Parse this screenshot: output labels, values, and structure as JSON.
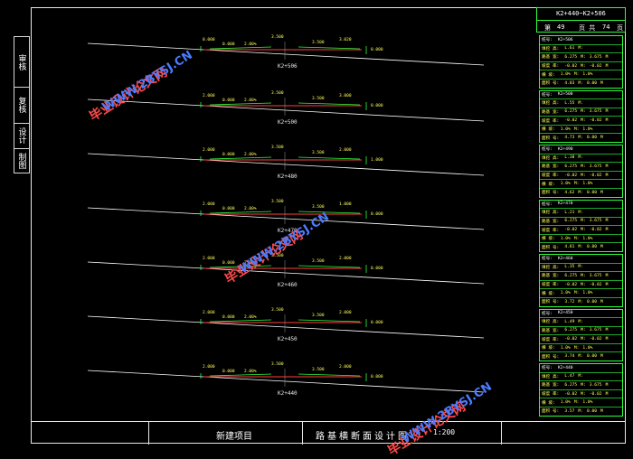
{
  "left_tab": {
    "cells": [
      "审核",
      "复核",
      "设计",
      "制图"
    ]
  },
  "sheet": {
    "title": "K2+440~K2+506",
    "page_current": "49",
    "page_total": "74"
  },
  "sections": [
    {
      "station": "K2+506",
      "left": [
        "0.000",
        "0.000"
      ],
      "right": [
        "3.020",
        "0.000"
      ],
      "mid": [
        "3.500",
        "2.00%"
      ]
    },
    {
      "station": "K2+500",
      "left": [
        "2.000",
        "0.000"
      ],
      "right": [
        "3.000",
        "0.000"
      ],
      "mid": [
        "3.500",
        "2.00%"
      ]
    },
    {
      "station": "K2+480",
      "left": [
        "2.000",
        "0.000"
      ],
      "right": [
        "2.000",
        "1.000"
      ],
      "mid": [
        "3.500",
        "2.00%"
      ]
    },
    {
      "station": "K2+470",
      "left": [
        "2.000",
        "0.000"
      ],
      "right": [
        "1.000",
        "0.000"
      ],
      "mid": [
        "3.500",
        "2.00%"
      ]
    },
    {
      "station": "K2+460",
      "left": [
        "2.000",
        "0.000"
      ],
      "right": [
        "2.000",
        "0.000"
      ],
      "mid": [
        "3.500",
        "2.00%"
      ]
    },
    {
      "station": "K2+450",
      "left": [
        "2.000",
        "0.000"
      ],
      "right": [
        "2.000",
        "0.000"
      ],
      "mid": [
        "3.500",
        "2.00%"
      ]
    },
    {
      "station": "K2+440",
      "left": [
        "2.000",
        "0.000"
      ],
      "right": [
        "2.000",
        "0.000"
      ],
      "mid": [
        "3.500",
        "2.00%"
      ]
    }
  ],
  "tables": [
    {
      "station": "K2+506",
      "rows": [
        [
          "桩号:",
          "K2+506"
        ],
        [
          "填挖 高:",
          "L.61",
          "M:"
        ],
        [
          "路基 宽:",
          "6.275",
          "M:",
          "3.675",
          "M"
        ],
        [
          "坡度 率:",
          "-0.02",
          "M:",
          "-0.02",
          "M"
        ],
        [
          "横 坡:",
          "1.0%",
          "M:",
          "1.0%"
        ],
        [
          "面积 号:",
          "4.83",
          "M:",
          "0.00",
          "M"
        ]
      ]
    },
    {
      "station": "K2+500",
      "rows": [
        [
          "桩号:",
          "K2+500"
        ],
        [
          "填挖 高:",
          "L.55",
          "M:"
        ],
        [
          "路基 宽:",
          "6.275",
          "M:",
          "3.675",
          "M"
        ],
        [
          "坡度 率:",
          "-0.02",
          "M:",
          "-0.02",
          "M"
        ],
        [
          "横 坡:",
          "1.0%",
          "M:",
          "1.0%"
        ],
        [
          "面积 号:",
          "4.73",
          "M:",
          "0.00",
          "M"
        ]
      ]
    },
    {
      "station": "K2+490",
      "rows": [
        [
          "桩号:",
          "K2+490"
        ],
        [
          "填挖 高:",
          "L.38",
          "M:"
        ],
        [
          "路基 宽:",
          "6.275",
          "M:",
          "3.675",
          "M"
        ],
        [
          "坡度 率:",
          "-0.02",
          "M:",
          "-0.02",
          "M"
        ],
        [
          "横 坡:",
          "1.0%",
          "M:",
          "1.0%"
        ],
        [
          "面积 号:",
          "4.62",
          "M:",
          "0.00",
          "M"
        ]
      ]
    },
    {
      "station": "K2+470",
      "rows": [
        [
          "桩号:",
          "K2+470"
        ],
        [
          "填挖 高:",
          "L.21",
          "M:"
        ],
        [
          "路基 宽:",
          "6.275",
          "M:",
          "3.675",
          "M"
        ],
        [
          "坡度 率:",
          "-0.02",
          "M:",
          "-0.02",
          "M"
        ],
        [
          "横 坡:",
          "1.0%",
          "M:",
          "1.0%"
        ],
        [
          "面积 号:",
          "4.81",
          "M:",
          "0.00",
          "M"
        ]
      ]
    },
    {
      "station": "K2+460",
      "rows": [
        [
          "桩号:",
          "K2+460"
        ],
        [
          "填挖 高:",
          "L.35",
          "M:"
        ],
        [
          "路基 宽:",
          "6.275",
          "M:",
          "3.675",
          "M"
        ],
        [
          "坡度 率:",
          "-0.02",
          "M:",
          "-0.02",
          "M"
        ],
        [
          "横 坡:",
          "1.0%",
          "M:",
          "1.0%"
        ],
        [
          "面积 号:",
          "3.72",
          "M:",
          "0.00",
          "M"
        ]
      ]
    },
    {
      "station": "K2+450",
      "rows": [
        [
          "桩号:",
          "K2+450"
        ],
        [
          "填挖 高:",
          "L.49",
          "M:"
        ],
        [
          "路基 宽:",
          "6.275",
          "M:",
          "3.675",
          "M"
        ],
        [
          "坡度 率:",
          "-0.02",
          "M:",
          "-0.02",
          "M"
        ],
        [
          "横 坡:",
          "1.0%",
          "M:",
          "1.0%"
        ],
        [
          "面积 号:",
          "3.74",
          "M:",
          "0.00",
          "M"
        ]
      ]
    },
    {
      "station": "K2+440",
      "rows": [
        [
          "桩号:",
          "K2+440"
        ],
        [
          "填挖 高:",
          "L.47",
          "M:"
        ],
        [
          "路基 宽:",
          "6.275",
          "M:",
          "3.675",
          "M"
        ],
        [
          "坡度 率:",
          "-0.02",
          "M:",
          "-0.02",
          "M"
        ],
        [
          "横 坡:",
          "1.0%",
          "M:",
          "1.0%"
        ],
        [
          "面积 号:",
          "3.57",
          "M:",
          "0.00",
          "M"
        ]
      ]
    }
  ],
  "title_block": {
    "project": "新建项目",
    "drawing": "路基横断面设计图",
    "scale": "1:200"
  },
  "watermarks": [
    {
      "text": "毕业设计论文网",
      "color": "red"
    },
    {
      "text": "WWW.2BYSJ.CN",
      "color": "blue"
    }
  ],
  "colors": {
    "frame": "#e8e8e8",
    "table_border": "#2fff3a",
    "dim_text": "#ffff5a",
    "ground_line": "#ffffff",
    "design_line": "#ff4040",
    "watermark_red": "#ff4b4b",
    "watermark_blue": "#4b7bff"
  }
}
